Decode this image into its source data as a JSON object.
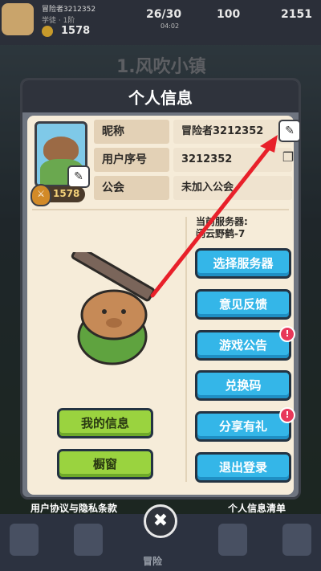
{
  "topbar": {
    "player_name": "冒险者3212352",
    "player_sub": "学徒 · 1阶",
    "coins": "1578",
    "energy": "26/30",
    "energy_sub": "04:02",
    "gems": "100",
    "gold": "2151"
  },
  "stage_title": "1.风吹小镇",
  "modal": {
    "title": "个人信息",
    "level": "1578",
    "fields": [
      {
        "label": "昵称",
        "value": "冒险者3212352"
      },
      {
        "label": "用户序号",
        "value": "3212352"
      },
      {
        "label": "公会",
        "value": "未加入公会"
      }
    ],
    "server_label": "当前服务器:",
    "server_name": "闲云野鹤-7",
    "right_buttons": [
      {
        "label": "选择服务器",
        "badge": false
      },
      {
        "label": "意见反馈",
        "badge": false
      },
      {
        "label": "游戏公告",
        "badge": true
      },
      {
        "label": "兑换码",
        "badge": false
      },
      {
        "label": "分享有礼",
        "badge": true
      },
      {
        "label": "退出登录",
        "badge": false
      }
    ],
    "left_buttons": [
      {
        "label": "我的信息"
      },
      {
        "label": "橱窗"
      }
    ]
  },
  "footer": {
    "privacy_link": "用户协议与隐私条款",
    "info_list_link": "个人信息清单",
    "close_icon": "close-icon",
    "nav_label": "冒险"
  },
  "annotation": {
    "arrow_color": "#e8202a"
  },
  "badge_text": "!"
}
